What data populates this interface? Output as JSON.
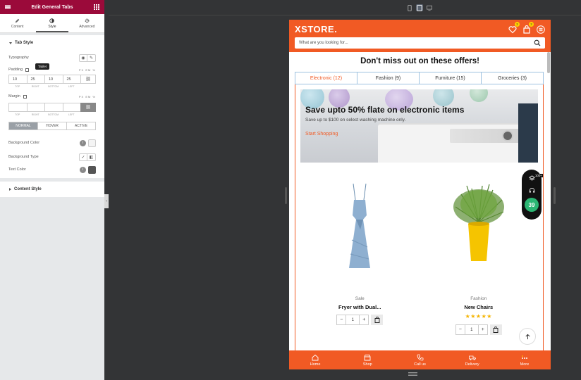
{
  "editor": {
    "panel_title": "Edit General Tabs",
    "tabs": [
      {
        "label": "Content"
      },
      {
        "label": "Style"
      },
      {
        "label": "Advanced"
      }
    ],
    "section_tab_style": "Tab Style",
    "typography_label": "Typography",
    "padding_label": "Padding",
    "tooltip": "Tablet",
    "units": "PX  EM  %",
    "padding_values": [
      "10",
      "25",
      "10",
      "25"
    ],
    "dim_labels": [
      "TOP",
      "RIGHT",
      "BOTTOM",
      "LEFT"
    ],
    "margin_label": "Margin",
    "state_tabs": [
      "NORMAL",
      "HOVER",
      "ACTIVE"
    ],
    "bg_color_label": "Background Color",
    "bg_type_label": "Background Type",
    "text_color_label": "Text Color",
    "section_content_style": "Content Style"
  },
  "site": {
    "logo": "XSTORE.",
    "wishlist_count": "2",
    "cart_count": "3",
    "search_placeholder": "What are you looking for...",
    "promo_title": "Don't miss out on these offers!",
    "category_tabs": [
      "Electronic (12)",
      "Fashion (9)",
      "Furniture (15)",
      "Groceries (3)"
    ],
    "banner": {
      "title": "Save upto 50% flate on electronic items",
      "subtitle": "Save up to $100 on select washing machine only.",
      "cta": "Start Shopping"
    },
    "products": [
      {
        "category": "Sale",
        "name": "Fryer with Dual...",
        "qty": "1",
        "rating": 0
      },
      {
        "category": "Fashion",
        "name": "New Chairs",
        "qty": "1",
        "rating": 5
      }
    ],
    "widget_badge": "100+",
    "widget_price": "39",
    "bottom_nav": [
      "Home",
      "Shop",
      "Call us",
      "Delivery",
      "More"
    ],
    "colors": {
      "brand": "#f15a24",
      "editor_header": "#9b0a3a",
      "price_badge": "#2bb673"
    }
  }
}
